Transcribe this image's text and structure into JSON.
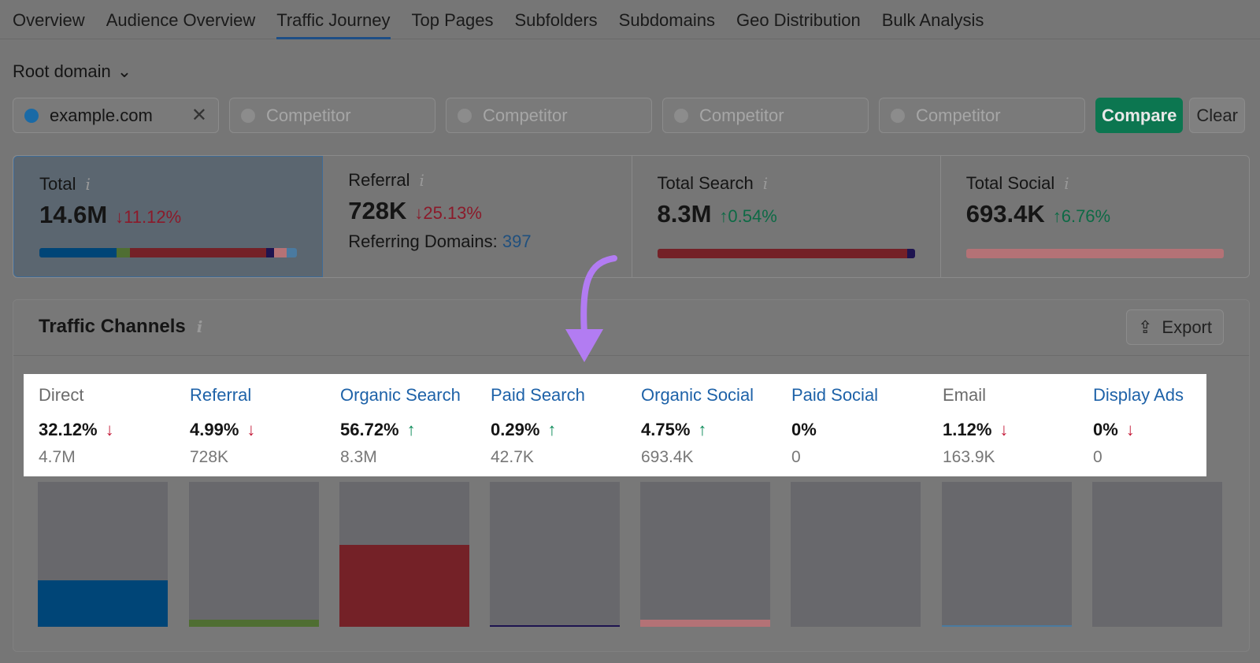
{
  "nav": {
    "tabs": [
      "Overview",
      "Audience Overview",
      "Traffic Journey",
      "Top Pages",
      "Subfolders",
      "Subdomains",
      "Geo Distribution",
      "Bulk Analysis"
    ],
    "active": 2
  },
  "scope": {
    "label": "Root domain"
  },
  "domains": {
    "main": "example.com",
    "competitor_placeholder": "Competitor",
    "compare": "Compare",
    "clear": "Clear"
  },
  "cards": [
    {
      "label": "Total",
      "value": "14.6M",
      "change": "11.12%",
      "dir": "down"
    },
    {
      "label": "Referral",
      "value": "728K",
      "change": "25.13%",
      "dir": "down",
      "sub_label": "Referring Domains:",
      "sub_value": "397"
    },
    {
      "label": "Total Search",
      "value": "8.3M",
      "change": "0.54%",
      "dir": "up"
    },
    {
      "label": "Total Social",
      "value": "693.4K",
      "change": "6.76%",
      "dir": "up"
    }
  ],
  "colors": {
    "direct": "#004577",
    "referral": "#4f6e32",
    "organic_search": "#742127",
    "paid_search": "#1e1450",
    "organic_social": "#b47276",
    "paid_social": "#8c5a8c",
    "email": "#4a7aa0",
    "display_ads": "#6a6a9a"
  },
  "panel": {
    "title": "Traffic Channels",
    "export": "Export"
  },
  "channels": [
    {
      "name": "Direct",
      "pct": "32.12%",
      "dir": "down",
      "value": "4.7M",
      "share": 32.12,
      "link": false,
      "color": "#004577"
    },
    {
      "name": "Referral",
      "pct": "4.99%",
      "dir": "down",
      "value": "728K",
      "share": 4.99,
      "link": true,
      "color": "#4f6e32"
    },
    {
      "name": "Organic Search",
      "pct": "56.72%",
      "dir": "up",
      "value": "8.3M",
      "share": 56.72,
      "link": true,
      "color": "#742127"
    },
    {
      "name": "Paid Search",
      "pct": "0.29%",
      "dir": "up",
      "value": "42.7K",
      "share": 0.29,
      "link": true,
      "color": "#1e1450"
    },
    {
      "name": "Organic Social",
      "pct": "4.75%",
      "dir": "up",
      "value": "693.4K",
      "share": 4.75,
      "link": true,
      "color": "#b47276"
    },
    {
      "name": "Paid Social",
      "pct": "0%",
      "dir": "none",
      "value": "0",
      "share": 0,
      "link": true,
      "color": "#8c5a8c"
    },
    {
      "name": "Email",
      "pct": "1.12%",
      "dir": "down",
      "value": "163.9K",
      "share": 1.12,
      "link": false,
      "color": "#4a7aa0"
    },
    {
      "name": "Display Ads",
      "pct": "0%",
      "dir": "down",
      "value": "0",
      "share": 0,
      "link": true,
      "color": "#6a6a9a"
    }
  ]
}
